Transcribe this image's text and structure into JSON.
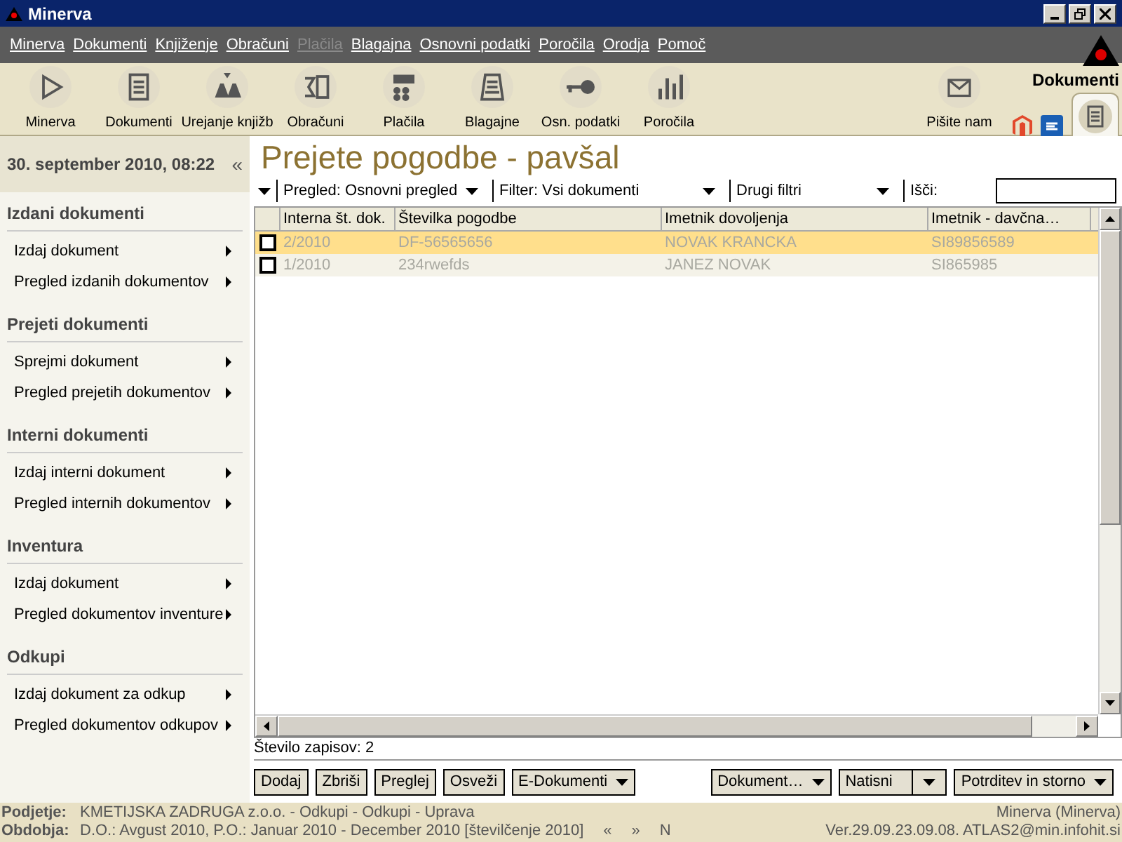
{
  "window": {
    "title": "Minerva"
  },
  "menu": [
    {
      "label": "Minerva",
      "disabled": false
    },
    {
      "label": "Dokumenti",
      "disabled": false
    },
    {
      "label": "Knjiženje",
      "disabled": false
    },
    {
      "label": "Obračuni",
      "disabled": false
    },
    {
      "label": "Plačila",
      "disabled": true
    },
    {
      "label": "Blagajna",
      "disabled": false
    },
    {
      "label": "Osnovni podatki",
      "disabled": false
    },
    {
      "label": "Poročila",
      "disabled": false
    },
    {
      "label": "Orodja",
      "disabled": false
    },
    {
      "label": "Pomoč",
      "disabled": false
    }
  ],
  "toolbar": [
    {
      "label": "Minerva",
      "kind": "play"
    },
    {
      "label": "Dokumenti",
      "kind": "doc"
    },
    {
      "label": "Urejanje knjižb",
      "kind": "book"
    },
    {
      "label": "Obračuni",
      "kind": "calc"
    },
    {
      "label": "Plačila",
      "kind": "coins"
    },
    {
      "label": "Blagajne",
      "kind": "register"
    },
    {
      "label": "Osn. podatki",
      "kind": "key"
    },
    {
      "label": "Poročila",
      "kind": "chart"
    }
  ],
  "mail": {
    "label": "Pišite nam"
  },
  "module": {
    "label": "Dokumenti"
  },
  "sidebar": {
    "datetime": "30. september 2010, 08:22",
    "collapse": "«",
    "sections": [
      {
        "title": "Izdani dokumenti",
        "items": [
          "Izdaj dokument",
          "Pregled izdanih dokumentov"
        ]
      },
      {
        "title": "Prejeti dokumenti",
        "items": [
          "Sprejmi dokument",
          "Pregled prejetih dokumentov"
        ]
      },
      {
        "title": "Interni dokumenti",
        "items": [
          "Izdaj interni dokument",
          "Pregled internih dokumentov"
        ]
      },
      {
        "title": "Inventura",
        "items": [
          "Izdaj dokument",
          "Pregled dokumentov inventure"
        ]
      },
      {
        "title": "Odkupi",
        "items": [
          "Izdaj dokument za odkup",
          "Pregled dokumentov odkupov"
        ]
      }
    ]
  },
  "page": {
    "title": "Prejete pogodbe - pavšal"
  },
  "filters": [
    {
      "label": "Pregled: Osnovni pregled"
    },
    {
      "label": "Filter: Vsi dokumenti"
    },
    {
      "label": "Drugi filtri"
    }
  ],
  "search": {
    "label": "Išči:"
  },
  "table": {
    "columns": [
      "Interna št. dok.",
      "Številka pogodbe",
      "Imetnik dovoljenja",
      "Imetnik - davčna…"
    ],
    "rows": [
      {
        "selected": true,
        "checked": false,
        "cells": [
          "2/2010",
          "DF-56565656",
          "NOVAK KRANCKA",
          "SI89856589"
        ]
      },
      {
        "selected": false,
        "checked": false,
        "cells": [
          "1/2010",
          "234rwefds",
          "JANEZ NOVAK",
          "SI865985"
        ]
      }
    ],
    "count": "Število zapisov: 2"
  },
  "buttons_left": [
    {
      "label": "Dodaj",
      "kind": "plain"
    },
    {
      "label": "Zbriši",
      "kind": "plain"
    },
    {
      "label": "Preglej",
      "kind": "plain"
    },
    {
      "label": "Osveži",
      "kind": "plain"
    },
    {
      "label": "E-Dokumenti",
      "kind": "menu"
    }
  ],
  "buttons_right": [
    {
      "label": "Dokument…",
      "kind": "menu"
    },
    {
      "label": "Natisni",
      "kind": "split"
    },
    {
      "label": "Potrditev in storno",
      "kind": "menu"
    }
  ],
  "status": [
    {
      "label": "Podjetje:",
      "value": "KMETIJSKA ZADRUGA z.o.o. - Odkupi - Odkupi - Uprava",
      "right": "Minerva (Minerva)"
    },
    {
      "label": "Obdobja:",
      "value": "D.O.: Avgust 2010, P.O.: Januar 2010 - December 2010 [številčenje 2010]",
      "nav": [
        "«",
        "»",
        "N"
      ],
      "right": "Ver.29.09.23.09.08. ATLAS2@min.infohit.si"
    }
  ]
}
